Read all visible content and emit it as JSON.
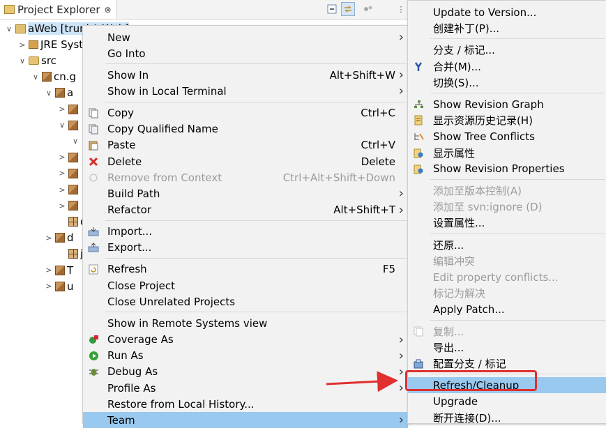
{
  "explorer": {
    "tab_title": "Project Explorer",
    "tab_close": "⊗",
    "tree": [
      {
        "label": "aWeb [trunk/aWeb]",
        "twisty": "∨",
        "icon": "proj",
        "indent": 0
      },
      {
        "label": "JRE System Library",
        "twisty": ">",
        "icon": "lib",
        "indent": 1
      },
      {
        "label": "src",
        "twisty": "∨",
        "icon": "folder",
        "indent": 1
      },
      {
        "label": "cn.g",
        "twisty": "∨",
        "icon": "pkg",
        "indent": 2
      },
      {
        "label": "a",
        "twisty": "∨",
        "icon": "pkg",
        "indent": 3
      },
      {
        "label": "",
        "twisty": ">",
        "icon": "pkg",
        "indent": 4
      },
      {
        "label": "",
        "twisty": "∨",
        "icon": "pkg",
        "indent": 4
      },
      {
        "label": "",
        "twisty": "∨",
        "icon": "none",
        "indent": 5
      },
      {
        "label": "",
        "twisty": ">",
        "icon": "pkg",
        "indent": 4
      },
      {
        "label": "",
        "twisty": ">",
        "icon": "pkg",
        "indent": 4
      },
      {
        "label": "",
        "twisty": ">",
        "icon": "pkg",
        "indent": 4
      },
      {
        "label": "",
        "twisty": ">",
        "icon": "pkg",
        "indent": 4
      },
      {
        "label": "d",
        "twisty": "",
        "icon": "grid",
        "indent": 4
      },
      {
        "label": "d",
        "twisty": ">",
        "icon": "pkg",
        "indent": 3
      },
      {
        "label": "ju",
        "twisty": "",
        "icon": "grid",
        "indent": 4
      },
      {
        "label": "T",
        "twisty": ">",
        "icon": "pkg",
        "indent": 3
      },
      {
        "label": "u",
        "twisty": ">",
        "icon": "pkg",
        "indent": 3
      }
    ]
  },
  "context_menu": [
    {
      "label": "New",
      "arrow": true
    },
    {
      "label": "Go Into"
    },
    {
      "sep": true
    },
    {
      "label": "Show In",
      "accel": "Alt+Shift+W",
      "arrow": true
    },
    {
      "label": "Show in Local Terminal",
      "arrow": true
    },
    {
      "sep": true
    },
    {
      "label": "Copy",
      "accel": "Ctrl+C",
      "icon": "copy-icon"
    },
    {
      "label": "Copy Qualified Name",
      "icon": "copy-qualified-icon"
    },
    {
      "label": "Paste",
      "accel": "Ctrl+V",
      "icon": "paste-icon"
    },
    {
      "label": "Delete",
      "accel": "Delete",
      "icon": "delete-icon"
    },
    {
      "label": "Remove from Context",
      "accel": "Ctrl+Alt+Shift+Down",
      "icon": "remove-context-icon",
      "disabled": true
    },
    {
      "label": "Build Path",
      "arrow": true
    },
    {
      "label": "Refactor",
      "accel": "Alt+Shift+T",
      "arrow": true
    },
    {
      "sep": true
    },
    {
      "label": "Import...",
      "icon": "import-icon"
    },
    {
      "label": "Export...",
      "icon": "export-icon"
    },
    {
      "sep": true
    },
    {
      "label": "Refresh",
      "accel": "F5",
      "icon": "refresh-icon"
    },
    {
      "label": "Close Project"
    },
    {
      "label": "Close Unrelated Projects"
    },
    {
      "sep": true
    },
    {
      "label": "Show in Remote Systems view"
    },
    {
      "label": "Coverage As",
      "arrow": true,
      "icon": "coverage-icon"
    },
    {
      "label": "Run As",
      "arrow": true,
      "icon": "run-icon"
    },
    {
      "label": "Debug As",
      "arrow": true,
      "icon": "debug-icon"
    },
    {
      "label": "Profile As",
      "arrow": true
    },
    {
      "label": "Restore from Local History..."
    },
    {
      "label": "Team",
      "arrow": true,
      "highlighted": true
    }
  ],
  "team_menu": [
    {
      "label": "Update to Version..."
    },
    {
      "label": "创建补丁(P)..."
    },
    {
      "sep": true
    },
    {
      "label": "分支 / 标记..."
    },
    {
      "label": "合并(M)...",
      "icon": "merge-icon"
    },
    {
      "label": "切换(S)..."
    },
    {
      "sep": true
    },
    {
      "label": "Show Revision Graph",
      "icon": "revision-graph-icon"
    },
    {
      "label": "显示资源历史记录(H)",
      "icon": "history-icon"
    },
    {
      "label": "Show Tree Conflicts",
      "icon": "tree-conflicts-icon"
    },
    {
      "label": "显示属性",
      "icon": "properties-icon"
    },
    {
      "label": "Show Revision Properties",
      "icon": "revision-properties-icon"
    },
    {
      "sep": true
    },
    {
      "label": "添加至版本控制(A)",
      "disabled": true
    },
    {
      "label": "添加至 svn:ignore (D)",
      "disabled": true
    },
    {
      "label": "设置属性..."
    },
    {
      "sep": true
    },
    {
      "label": "还原..."
    },
    {
      "label": "编辑冲突",
      "disabled": true
    },
    {
      "label": "Edit property conflicts...",
      "disabled": true
    },
    {
      "label": "标记为解决",
      "disabled": true
    },
    {
      "label": "Apply Patch..."
    },
    {
      "sep": true
    },
    {
      "label": "复制...",
      "disabled": true,
      "icon": "copy-disabled-icon"
    },
    {
      "label": "导出..."
    },
    {
      "label": "配置分支 / 标记",
      "icon": "configure-branch-icon"
    },
    {
      "sep": true
    },
    {
      "label": "Refresh/Cleanup",
      "highlighted": true
    },
    {
      "label": "Upgrade"
    },
    {
      "label": "断开连接(D)..."
    }
  ],
  "colors": {
    "menu_bg": "#f2f2f2",
    "highlight": "#99c9ef",
    "callout": "#e03030",
    "selection": "#cce4f7"
  }
}
